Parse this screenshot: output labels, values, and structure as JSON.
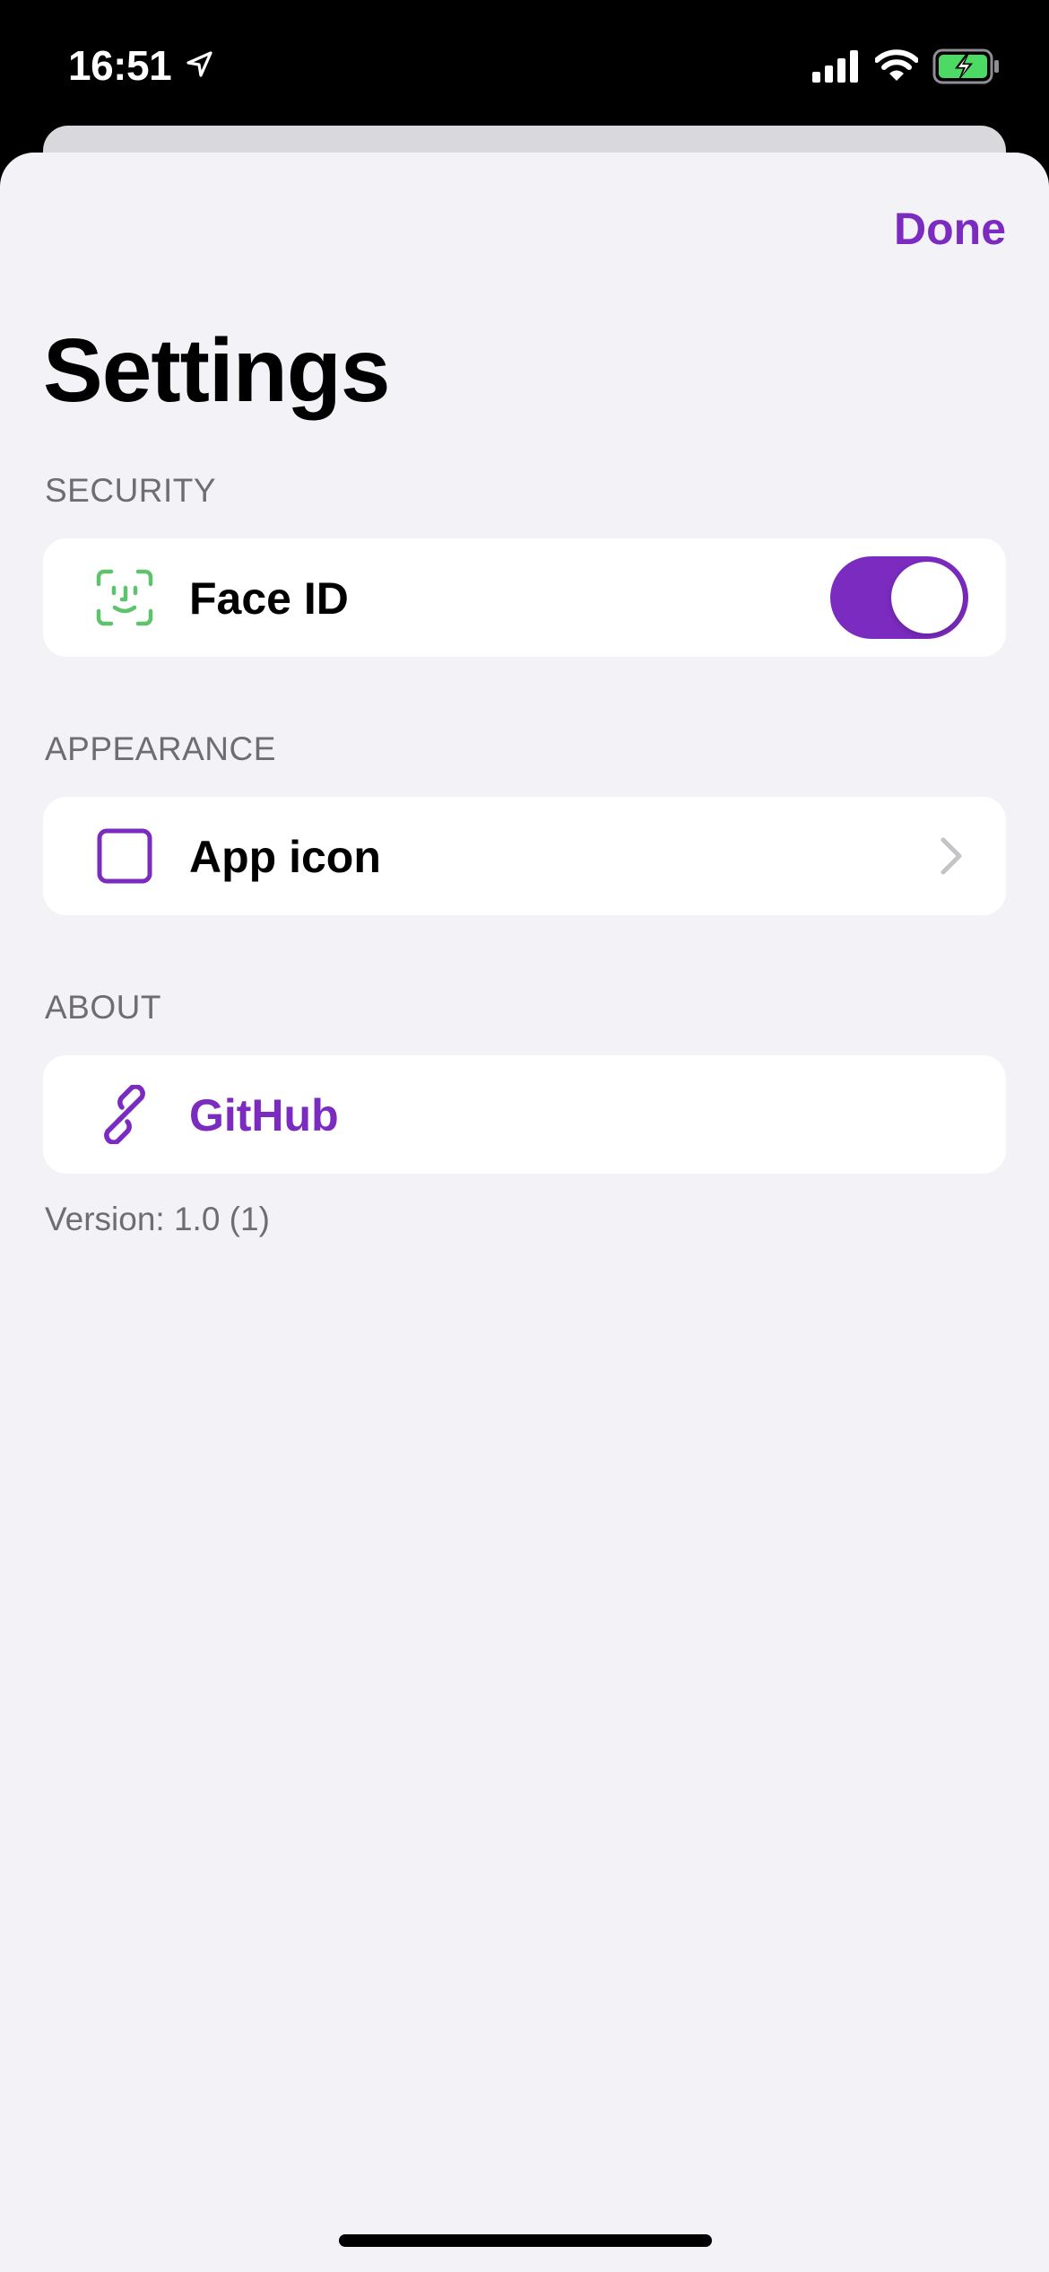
{
  "status_bar": {
    "time": "16:51",
    "icons": [
      "location-arrow-icon",
      "cellular-signal-icon",
      "wifi-icon",
      "battery-charging-icon"
    ]
  },
  "header": {
    "done_label": "Done",
    "title": "Settings"
  },
  "sections": {
    "security": {
      "header": "SECURITY",
      "face_id": {
        "label": "Face ID",
        "icon": "face-id-icon",
        "enabled": true
      }
    },
    "appearance": {
      "header": "APPEARANCE",
      "app_icon": {
        "label": "App icon",
        "icon": "square-icon"
      }
    },
    "about": {
      "header": "ABOUT",
      "github": {
        "label": "GitHub",
        "icon": "link-icon"
      },
      "version": "Version: 1.0 (1)"
    }
  },
  "colors": {
    "accent": "#7b2bbf",
    "face_id_green": "#5ec46c",
    "background": "#f2f2f7",
    "secondary_text": "#6d6d72"
  }
}
